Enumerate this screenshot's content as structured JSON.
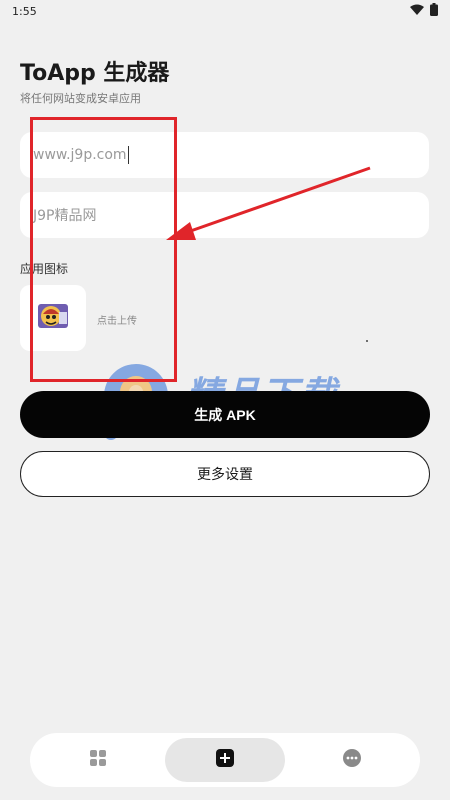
{
  "status_bar": {
    "time": "1:55",
    "icons": [
      "wifi-icon",
      "battery-icon"
    ]
  },
  "header": {
    "title": "ToApp 生成器",
    "subtitle": "将任何网站变成安卓应用"
  },
  "form": {
    "url_value": "www.j9p.com",
    "name_value": "J9P精品网",
    "icon_label": "应用图标",
    "upload_hint": "点击上传"
  },
  "actions": {
    "generate_label": "生成 APK",
    "more_settings_label": "更多设置"
  },
  "watermark": {
    "text": "精品下载",
    "url": "www.j9p.com"
  },
  "bottom_nav": {
    "items": [
      {
        "icon": "grid-icon",
        "active": false
      },
      {
        "icon": "add-box-icon",
        "active": true
      },
      {
        "icon": "more-icon",
        "active": false
      }
    ]
  },
  "colors": {
    "background": "#f0f0f0",
    "primary_button": "#050505",
    "annotation_red": "#e0252a",
    "watermark_blue": "#2f6fd6"
  }
}
